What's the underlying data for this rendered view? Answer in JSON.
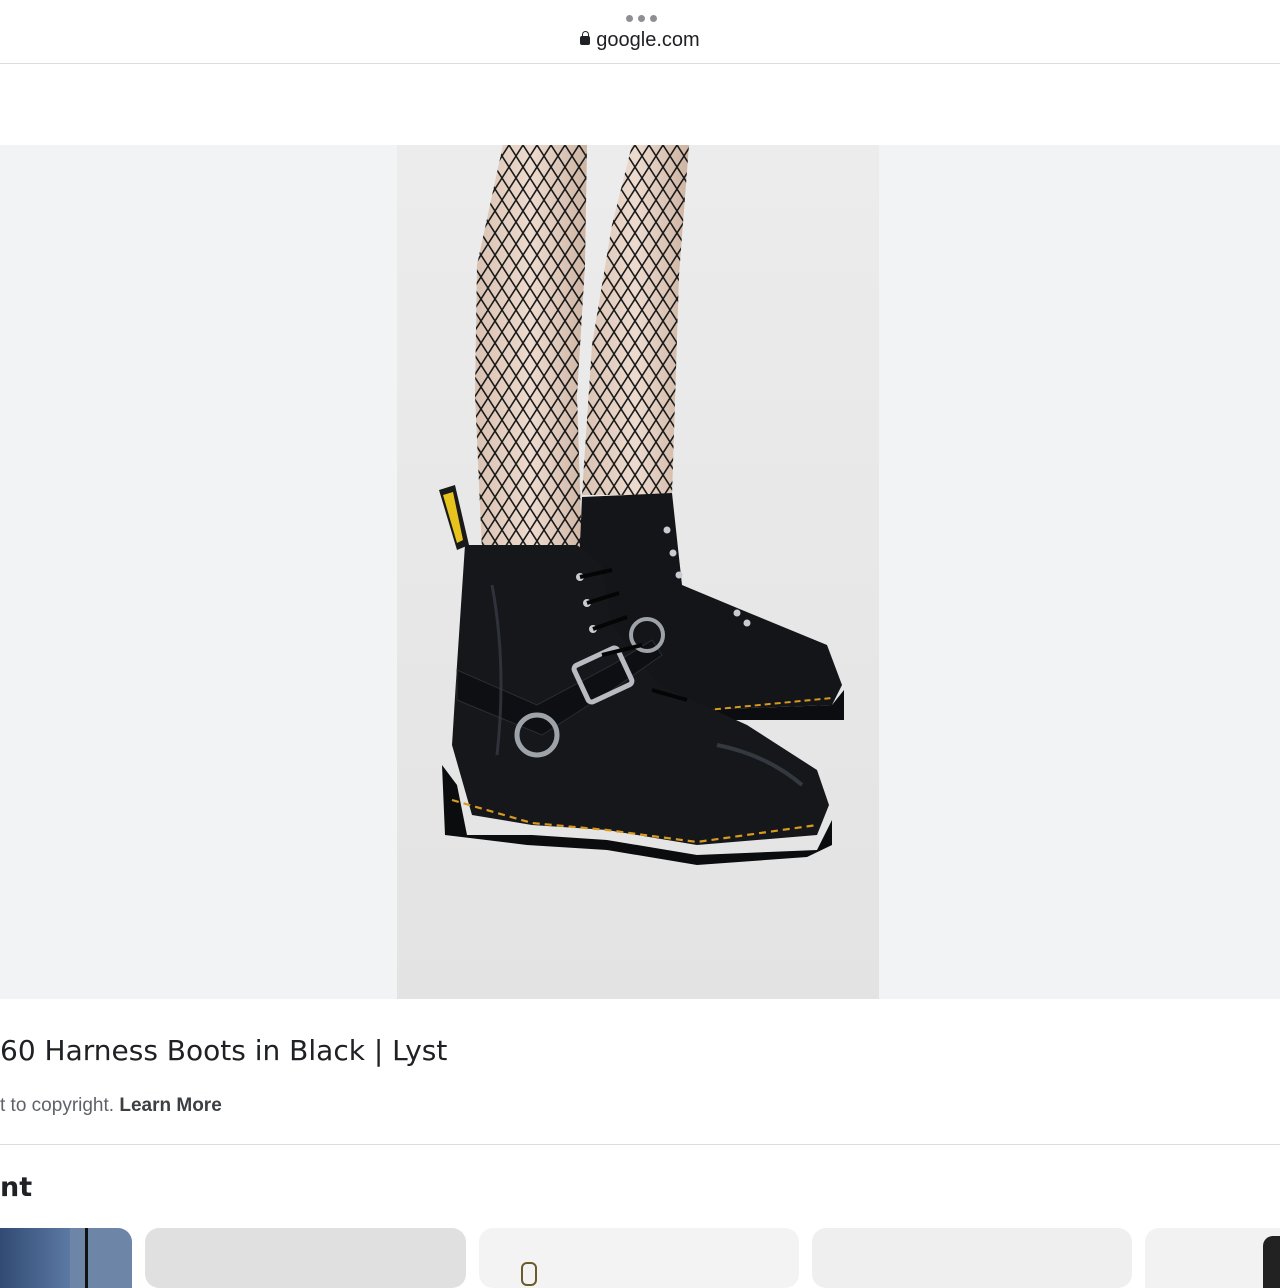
{
  "browser": {
    "url": "google.com"
  },
  "image_viewer": {
    "image_description": "black leather lace-up harness ankle boots with fishnet tights",
    "title": "60 Harness Boots in Black | Lyst",
    "copyright_notice": "t to copyright.",
    "learn_more_label": "Learn More"
  },
  "related": {
    "heading": "nt"
  },
  "colors": {
    "viewer_bg": "#f1f3f4",
    "divider": "#dadce0",
    "text_primary": "#202124",
    "text_secondary": "#5f6368"
  }
}
